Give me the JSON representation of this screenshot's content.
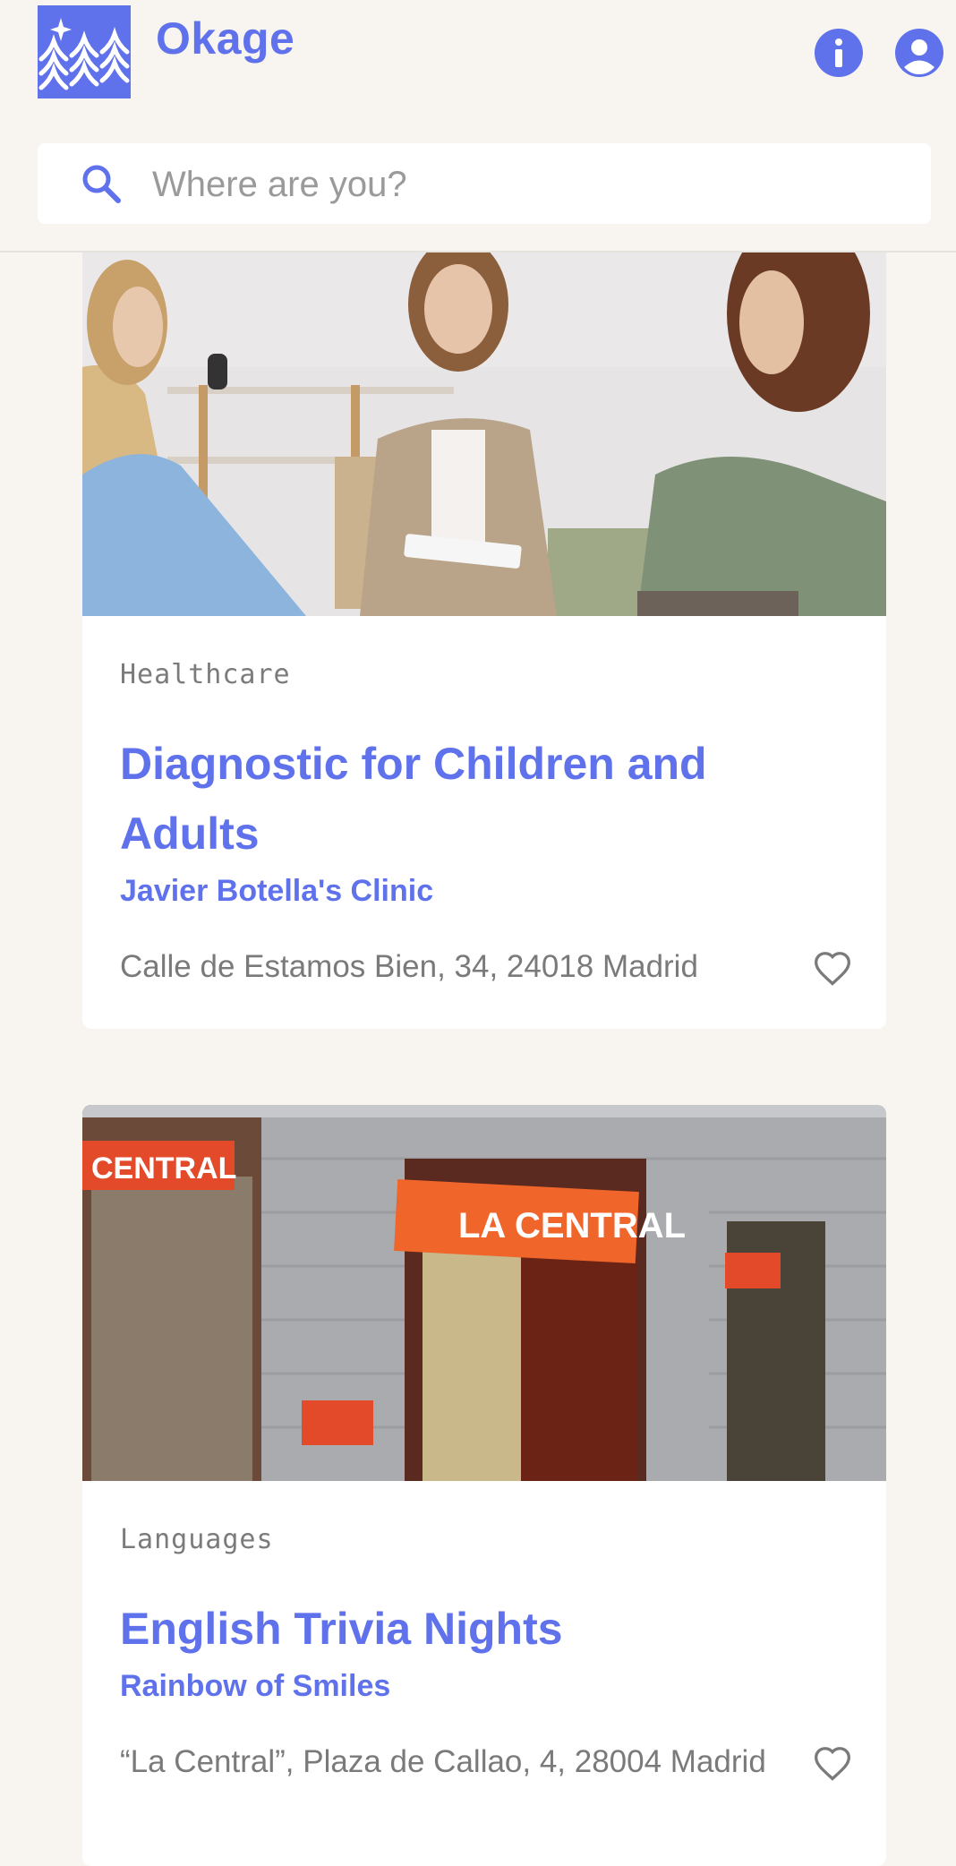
{
  "app": {
    "name": "Okage",
    "brand_color": "#5f72ec"
  },
  "search": {
    "placeholder": "Where are you?",
    "value": ""
  },
  "listings": [
    {
      "category": "Healthcare",
      "title": "Diagnostic for Children and Adults",
      "organization": "Javier Botella's Clinic",
      "address": "Calle de Estamos Bien, 34, 24018 Madrid",
      "favorite_icon": "heart-outline-icon"
    },
    {
      "category": "Languages",
      "title": "English Trivia Nights",
      "organization": "Rainbow of Smiles",
      "address": "“La Central”, Plaza de Callao, 4, 28004 Madrid",
      "favorite_icon": "heart-outline-icon"
    }
  ]
}
